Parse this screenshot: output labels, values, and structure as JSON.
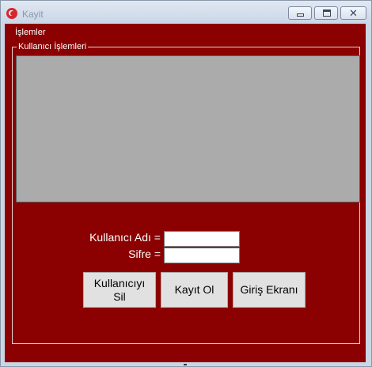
{
  "window": {
    "title": "Kayit",
    "app_icon": "turkish-flag-icon",
    "controls": {
      "minimize_icon": "minimize-icon",
      "maximize_icon": "maximize-icon",
      "close_icon": "close-icon",
      "close_glyph": "✕"
    }
  },
  "menu": {
    "label": "İşlemler"
  },
  "group": {
    "legend": "Kullanıcı İşlemleri",
    "grid": {
      "rows": []
    }
  },
  "form": {
    "username_label": "Kullanıcı Adı =",
    "username_value": "",
    "password_label": "Sifre =",
    "password_value": ""
  },
  "buttons": {
    "delete_user": "Kullanıcıyı\nSil",
    "register": "Kayıt Ol",
    "login_screen": "Giriş Ekranı"
  },
  "colors": {
    "client_background": "#8b0000",
    "grid_background": "#ababab",
    "button_face": "#e1e1e1",
    "label_text": "#ffffff"
  }
}
